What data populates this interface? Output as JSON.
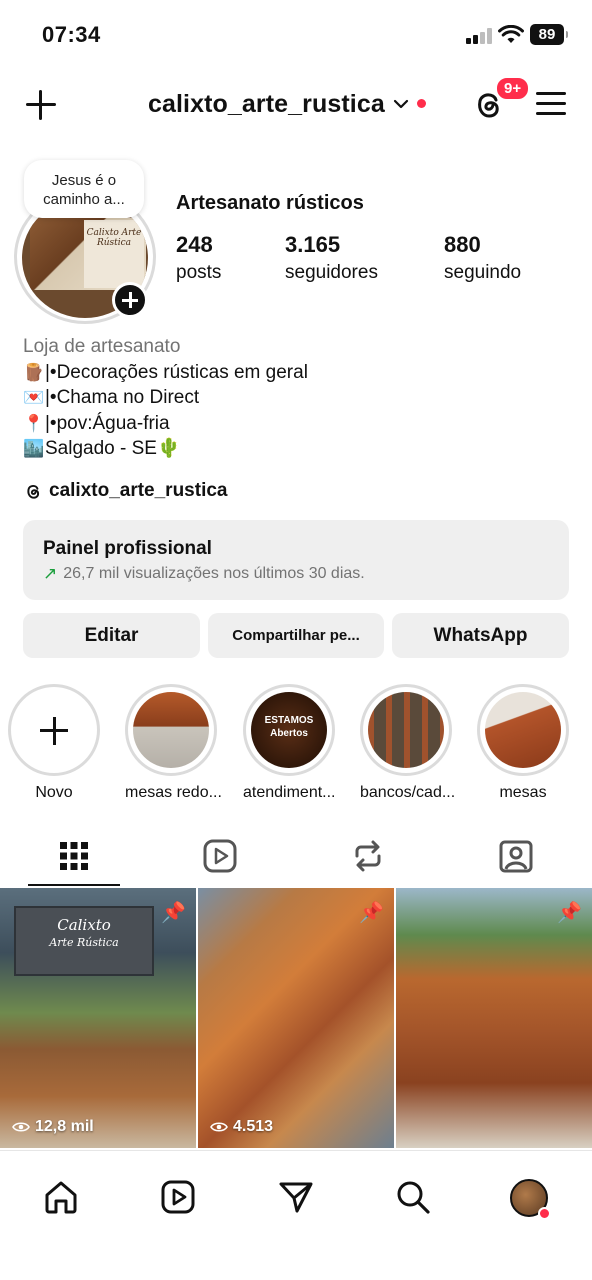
{
  "status_bar": {
    "time": "07:34",
    "battery": "89"
  },
  "header": {
    "username": "calixto_arte_rustica",
    "notification_badge": "9+"
  },
  "profile": {
    "note": "Jesus é o caminho a...",
    "name": "Artesanato rústicos",
    "stats": [
      {
        "value": "248",
        "label": "posts"
      },
      {
        "value": "3.165",
        "label": "seguidores"
      },
      {
        "value": "880",
        "label": "seguindo"
      }
    ],
    "category": "Loja de artesanato",
    "bio_lines": [
      {
        "emoji": "🪵",
        "text": "|•Decorações rústicas em geral"
      },
      {
        "emoji": "💌",
        "text": "|•Chama no Direct"
      },
      {
        "emoji": "📍",
        "text": "|•pov:Água-fria"
      },
      {
        "emoji": "🏙️",
        "text": "Salgado - SE🌵"
      }
    ],
    "threads_handle": "calixto_arte_rustica",
    "avatar_sign_text": "Calixto Arte Rústica"
  },
  "dashboard": {
    "title": "Painel profissional",
    "subtitle": "26,7 mil visualizações nos últimos 30 dias.",
    "trend_color": "#1a9e3c"
  },
  "actions": {
    "edit": "Editar",
    "share": "Compartilhar pe...",
    "whatsapp": "WhatsApp"
  },
  "highlights": [
    {
      "label": "Novo"
    },
    {
      "label": "mesas redo..."
    },
    {
      "label": "atendiment...",
      "image_text": "ESTAMOS Abertos"
    },
    {
      "label": "bancos/cad..."
    },
    {
      "label": "mesas"
    }
  ],
  "tabs": [
    "grid-icon",
    "reels-icon",
    "reposts-icon",
    "tagged-icon"
  ],
  "posts": [
    {
      "views": "12,8 mil",
      "pinned": true,
      "sign_title": "Calixto",
      "sign_sub": "Arte Rústica"
    },
    {
      "views": "4.513",
      "pinned": true
    },
    {
      "views": "",
      "pinned": true
    }
  ],
  "bottom_nav": [
    "home-icon",
    "reels-icon",
    "send-icon",
    "search-icon",
    "profile-avatar"
  ],
  "colors": {
    "accent_red": "#ff2d4b",
    "secondary_text": "#737373",
    "button_bg": "#efefef"
  }
}
